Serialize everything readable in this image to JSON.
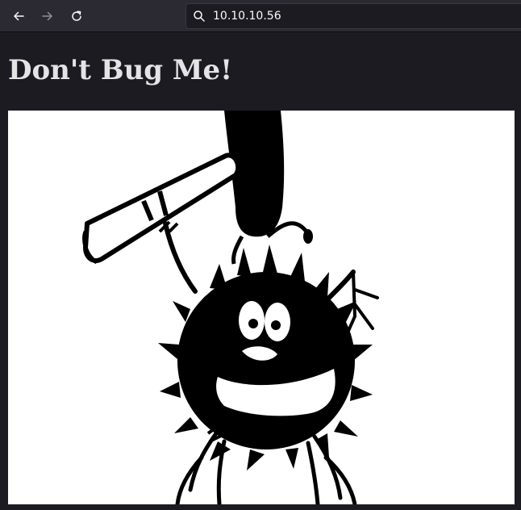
{
  "browser": {
    "address_bar": {
      "url": "10.10.10.56"
    },
    "icons": {
      "back": "back-arrow-icon",
      "forward": "forward-arrow-icon",
      "reload": "reload-icon",
      "search": "search-icon"
    },
    "colors": {
      "toolbar": "#2b2a33",
      "page_background": "#1c1b22",
      "heading_text": "#e4e4e4"
    }
  },
  "page": {
    "heading": "Don't Bug Me!",
    "image": {
      "subject": "cartoon bug being hit by a rolled-up newspaper"
    }
  }
}
